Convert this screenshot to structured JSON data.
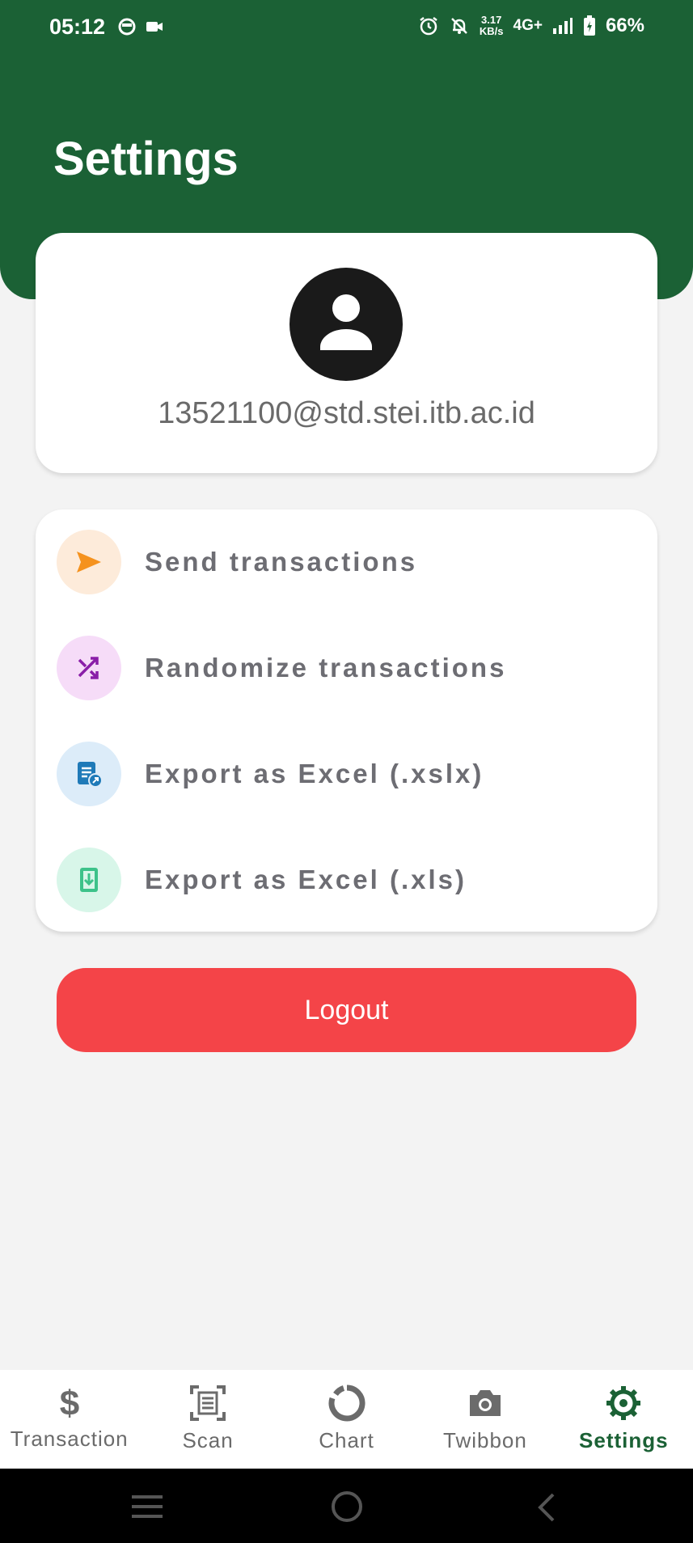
{
  "status_bar": {
    "time": "05:12",
    "speed_value": "3.17",
    "speed_unit": "KB/s",
    "network": "4G+",
    "battery": "66%"
  },
  "header": {
    "title": "Settings"
  },
  "profile": {
    "email": "13521100@std.stei.itb.ac.id"
  },
  "menu": {
    "items": [
      {
        "label": "Send transactions",
        "icon": "send-icon",
        "icon_color": "#f5921e",
        "bg_color": "#fdebda"
      },
      {
        "label": "Randomize transactions",
        "icon": "shuffle-icon",
        "icon_color": "#8a1ea8",
        "bg_color": "#f6dcf8"
      },
      {
        "label": "Export as Excel (.xslx)",
        "icon": "excel-export-icon",
        "icon_color": "#1f7ab8",
        "bg_color": "#dcecf9"
      },
      {
        "label": "Export as Excel (.xls)",
        "icon": "download-file-icon",
        "icon_color": "#3dc28a",
        "bg_color": "#d8f6e9"
      }
    ]
  },
  "logout": {
    "label": "Logout",
    "color": "#f44448"
  },
  "bottom_nav": {
    "items": [
      {
        "label": "Transaction",
        "icon": "dollar-icon"
      },
      {
        "label": "Scan",
        "icon": "scan-icon"
      },
      {
        "label": "Chart",
        "icon": "chart-ring-icon"
      },
      {
        "label": "Twibbon",
        "icon": "camera-icon"
      },
      {
        "label": "Settings",
        "icon": "gear-icon",
        "active": true
      }
    ]
  },
  "colors": {
    "primary": "#1b6135",
    "background": "#f3f3f3",
    "danger": "#f44448"
  }
}
